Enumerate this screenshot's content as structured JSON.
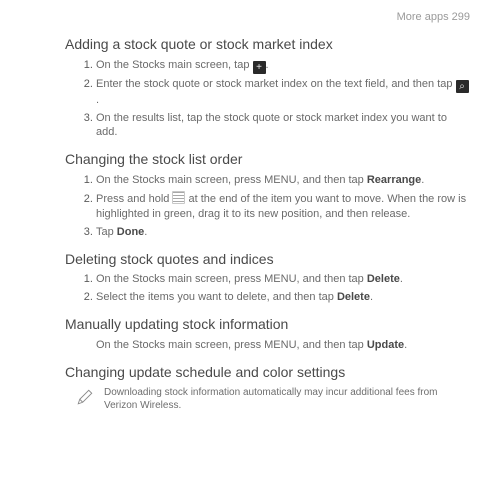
{
  "header": {
    "section": "More apps",
    "page": "299"
  },
  "s1": {
    "title": "Adding a stock quote or stock market index",
    "i1a": "On the Stocks main screen, tap ",
    "i2a": "Enter the stock quote or stock market index on the text field, and then tap ",
    "i3a": "On the results list, tap the stock quote or stock market index you want to add."
  },
  "icons": {
    "plus": "+",
    "search": "⌕"
  },
  "s2": {
    "title": "Changing the stock list order",
    "i1a": "On the Stocks main screen, press MENU, and then tap ",
    "i1b": "Rearrange",
    "i1c": ".",
    "i2a": "Press and hold ",
    "i2b": " at the end of the item you want to move. When the row is highlighted in green, drag it to its new position, and then release.",
    "i3a": "Tap ",
    "i3b": "Done",
    "i3c": "."
  },
  "s3": {
    "title": "Deleting stock quotes and indices",
    "i1a": "On the Stocks main screen, press MENU, and then tap ",
    "i1b": "Delete",
    "i1c": ".",
    "i2a": "Select the items you want to delete, and then tap ",
    "i2b": "Delete",
    "i2c": "."
  },
  "s4": {
    "title": "Manually updating stock information",
    "p1a": "On the Stocks main screen, press MENU, and then tap ",
    "p1b": "Update",
    "p1c": "."
  },
  "s5": {
    "title": "Changing update schedule and color settings",
    "note": "Downloading stock information automatically may incur additional fees from Verizon Wireless."
  }
}
